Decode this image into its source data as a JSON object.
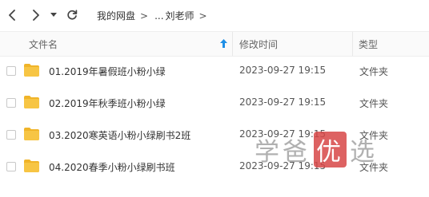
{
  "toolbar": {
    "back_icon": "chevron-left-icon",
    "forward_icon": "chevron-right-icon",
    "history_icon": "caret-down-icon",
    "refresh_icon": "refresh-icon"
  },
  "breadcrumb": {
    "root": "我的网盘",
    "ellipsis": "...",
    "current": "刘老师",
    "separator": ">"
  },
  "columns": {
    "name": "文件名",
    "sort_icon": "sort-up-arrow-icon",
    "modified": "修改时间",
    "type": "类型"
  },
  "files": [
    {
      "name": "01.2019年暑假班小粉小绿",
      "modified": "2023-09-27 19:15",
      "type": "文件夹"
    },
    {
      "name": "02.2019年秋季班小粉小绿",
      "modified": "2023-09-27 19:15",
      "type": "文件夹"
    },
    {
      "name": "03.2020寒英语小粉小绿刷书2班",
      "modified": "2023-09-27 19:15",
      "type": "文件夹"
    },
    {
      "name": "04.2020春季小粉小绿刷书班",
      "modified": "2023-09-27 19:15",
      "type": "文件夹"
    }
  ],
  "watermark": {
    "c1": "学",
    "c2": "爸",
    "c3": "优",
    "c4": "选"
  },
  "colors": {
    "folder": "#f7c544",
    "folder_tab": "#f0b429",
    "sort_arrow": "#1e8fe6",
    "watermark_red": "#d74646"
  }
}
